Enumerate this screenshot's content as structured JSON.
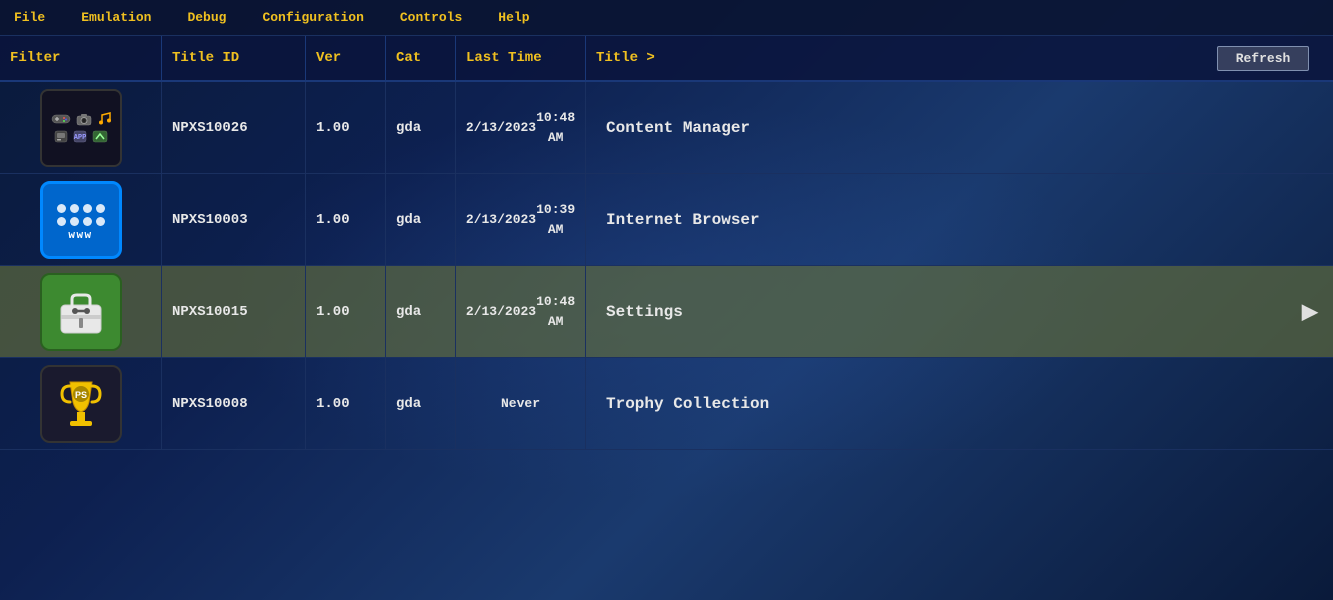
{
  "menubar": {
    "items": [
      {
        "id": "file",
        "label": "File"
      },
      {
        "id": "emulation",
        "label": "Emulation"
      },
      {
        "id": "debug",
        "label": "Debug"
      },
      {
        "id": "configuration",
        "label": "Configuration"
      },
      {
        "id": "controls",
        "label": "Controls"
      },
      {
        "id": "help",
        "label": "Help"
      }
    ]
  },
  "columns": {
    "filter": "Filter",
    "titleid": "Title ID",
    "ver": "Ver",
    "cat": "Cat",
    "lasttime": "Last Time",
    "title": "Title >",
    "refresh": "Refresh"
  },
  "rows": [
    {
      "id": "row-1",
      "titleid": "NPXS10026",
      "ver": "1.00",
      "cat": "gda",
      "lasttime_line1": "2/13/2023",
      "lasttime_line2": "10:48 AM",
      "title": "Content Manager",
      "icon_type": "cm",
      "selected": false
    },
    {
      "id": "row-2",
      "titleid": "NPXS10003",
      "ver": "1.00",
      "cat": "gda",
      "lasttime_line1": "2/13/2023",
      "lasttime_line2": "10:39 AM",
      "title": "Internet Browser",
      "icon_type": "ib",
      "selected": false
    },
    {
      "id": "row-3",
      "titleid": "NPXS10015",
      "ver": "1.00",
      "cat": "gda",
      "lasttime_line1": "2/13/2023",
      "lasttime_line2": "10:48 AM",
      "title": "Settings",
      "icon_type": "settings",
      "selected": true
    },
    {
      "id": "row-4",
      "titleid": "NPXS10008",
      "ver": "1.00",
      "cat": "gda",
      "lasttime_line1": "Never",
      "lasttime_line2": "",
      "title": "Trophy Collection",
      "icon_type": "trophy",
      "selected": false
    }
  ]
}
